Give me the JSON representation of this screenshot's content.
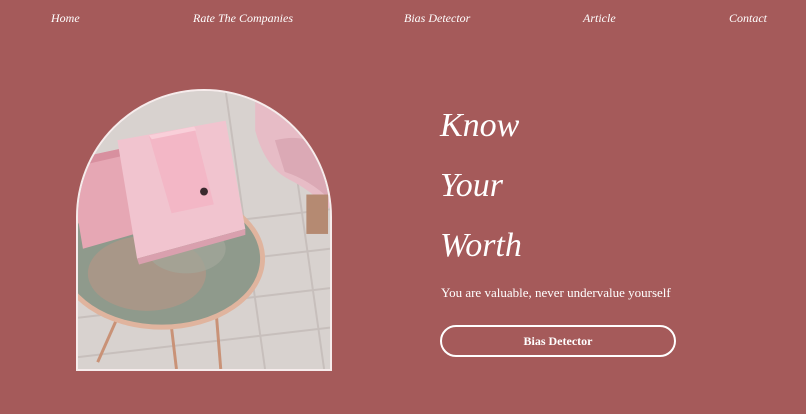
{
  "nav": {
    "items": [
      {
        "label": "Home"
      },
      {
        "label": "Rate The Companies"
      },
      {
        "label": "Bias Detector"
      },
      {
        "label": "Article"
      },
      {
        "label": "Contact"
      }
    ]
  },
  "hero": {
    "headline_lines": [
      "Know",
      "Your",
      "Worth"
    ],
    "subtitle": "You are valuable, never undervalue yourself",
    "cta_label": "Bias Detector"
  },
  "colors": {
    "background": "#a55a5a",
    "text": "#ffffff",
    "image_frame": "#f6ecec"
  }
}
